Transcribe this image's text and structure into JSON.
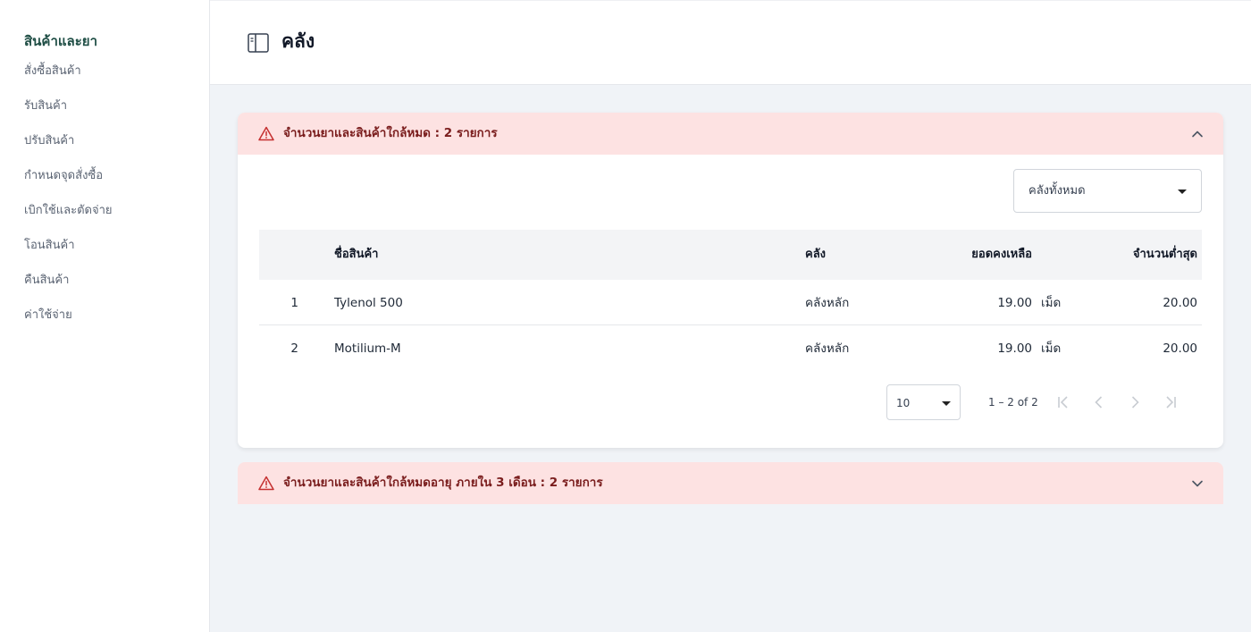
{
  "sidebar": {
    "title": "สินค้าและยา",
    "items": [
      {
        "label": "สั่งซื้อสินค้า"
      },
      {
        "label": "รับสินค้า"
      },
      {
        "label": "ปรับสินค้า"
      },
      {
        "label": "กำหนดจุดสั่งซื้อ"
      },
      {
        "label": "เบิกใช้และตัดจ่าย"
      },
      {
        "label": "โอนสินค้า"
      },
      {
        "label": "คืนสินค้า"
      },
      {
        "label": "ค่าใช้จ่าย"
      }
    ]
  },
  "header": {
    "title": "คลัง",
    "icon": "sidebar-panel-icon"
  },
  "low_stock_panel": {
    "title": "จำนวนยาและสินค้าใกล้หมด : 2 รายการ",
    "icon": "warning-icon",
    "expanded": true,
    "warehouse_filter": {
      "selected": "คลังทั้งหมด"
    },
    "table": {
      "columns": {
        "name": "ชื่อสินค้า",
        "store": "คลัง",
        "remaining": "ยอดคงเหลือ",
        "minimum": "จำนวนต่ำสุด"
      },
      "rows": [
        {
          "index": "1",
          "name": "Tylenol 500",
          "store": "คลังหลัก",
          "remaining": "19.00",
          "unit": "เม็ด",
          "minimum": "20.00"
        },
        {
          "index": "2",
          "name": "Motilium-M",
          "store": "คลังหลัก",
          "remaining": "19.00",
          "unit": "เม็ด",
          "minimum": "20.00"
        }
      ]
    },
    "pagination": {
      "page_size": "10",
      "range": "1 – 2 of 2"
    }
  },
  "expiring_panel": {
    "title": "จำนวนยาและสินค้าใกล้หมดอายุ ภายใน 3 เดือน : 2 รายการ",
    "icon": "warning-icon",
    "expanded": false
  },
  "colors": {
    "alert_bg": "#fde2e2",
    "alert_text": "#7a1d1d",
    "brand_green": "#1f4e45",
    "page_bg": "#f0f3f7"
  }
}
